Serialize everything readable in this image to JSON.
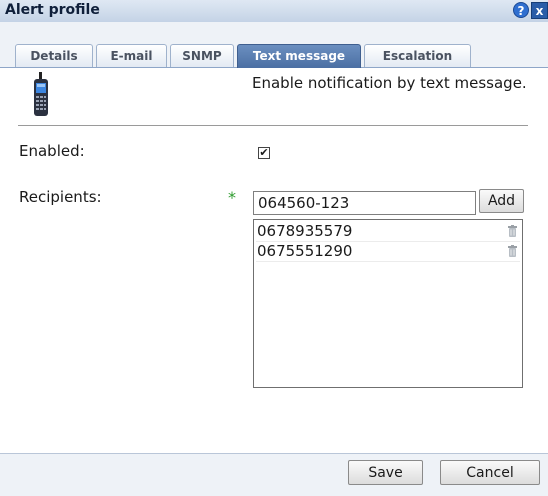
{
  "window": {
    "title": "Alert profile",
    "help_glyph": "?",
    "close_glyph": "x",
    "icons": [
      "help-icon",
      "close-icon"
    ]
  },
  "tabs": [
    {
      "label": "Details",
      "active": false
    },
    {
      "label": "E-mail",
      "active": false
    },
    {
      "label": "SNMP",
      "active": false
    },
    {
      "label": "Text message",
      "active": true
    },
    {
      "label": "Escalation",
      "active": false
    }
  ],
  "content": {
    "icon": "mobile-phone-icon",
    "intro": "Enable notification by text message."
  },
  "form": {
    "enabled_label": "Enabled:",
    "enabled_checked": true,
    "checkbox_glyph": "✔",
    "recipients_label": "Recipients:",
    "required_marker": "*",
    "recipient_input_value": "064560-123",
    "add_label": "Add",
    "recipients": [
      "0678935579",
      "0675551290"
    ],
    "delete_icon": "trash-icon"
  },
  "footer": {
    "save_label": "Save",
    "cancel_label": "Cancel"
  },
  "colors": {
    "title_bar": "#c4d3e6",
    "active_tab": "#5a7fb3",
    "required": "#2e9b2e"
  }
}
